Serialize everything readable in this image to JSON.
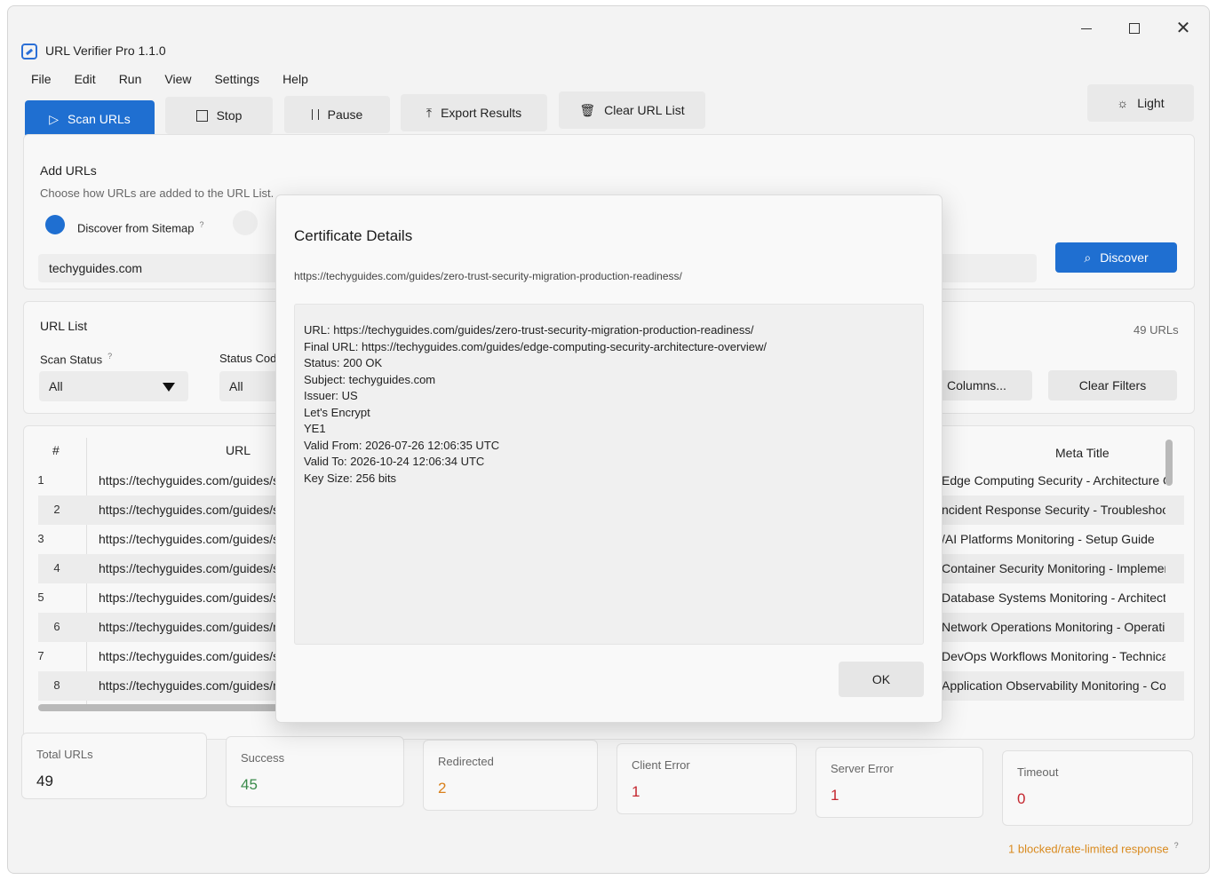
{
  "app": {
    "title": "URL Verifier Pro 1.1.0"
  },
  "menu": [
    "File",
    "Edit",
    "Run",
    "View",
    "Settings",
    "Help"
  ],
  "toolbar": {
    "scan": "Scan URLs",
    "stop": "Stop",
    "pause": "Pause",
    "export": "Export Results",
    "clear": "Clear URL List",
    "theme": "Light"
  },
  "add_urls": {
    "title": "Add URLs",
    "subtitle": "Choose how URLs are added to the URL List.",
    "option_sitemap": "Discover from Sitemap",
    "help": "?",
    "domain_value": "techyguides.com",
    "discover_button": "Discover"
  },
  "url_list": {
    "title": "URL List",
    "count": "49 URLs",
    "scan_status_label": "Scan Status",
    "scan_status_value": "All",
    "status_code_label": "Status Cod",
    "status_code_value": "All",
    "columns_button": "Columns...",
    "clear_filters_button": "Clear Filters",
    "help": "?"
  },
  "table": {
    "col_num": "#",
    "col_url": "URL",
    "col_meta": "Meta Title",
    "rows": [
      {
        "num": "1",
        "url": "https://techyguides.com/guides/s",
        "meta": "Edge Computing Security - Architecture Ove"
      },
      {
        "num": "2",
        "url": "https://techyguides.com/guides/s",
        "meta": "ncident Response Security - Troubleshootin"
      },
      {
        "num": "3",
        "url": "https://techyguides.com/guides/s",
        "meta": "/AI Platforms Monitoring - Setup Guide"
      },
      {
        "num": "4",
        "url": "https://techyguides.com/guides/s",
        "meta": "Container Security Monitoring - Implementa"
      },
      {
        "num": "5",
        "url": "https://techyguides.com/guides/s",
        "meta": "Database Systems Monitoring - Architecture"
      },
      {
        "num": "6",
        "url": "https://techyguides.com/guides/n",
        "meta": "Network Operations Monitoring - Operation"
      },
      {
        "num": "7",
        "url": "https://techyguides.com/guides/s",
        "meta": "DevOps Workflows Monitoring - Technical T"
      },
      {
        "num": "8",
        "url": "https://techyguides.com/guides/n",
        "meta": "Application Observability Monitoring - Com"
      }
    ]
  },
  "stats": [
    {
      "label": "Total URLs",
      "value": "49",
      "color": "#1f1f1f"
    },
    {
      "label": "Success",
      "value": "45",
      "color": "#3a8a4a"
    },
    {
      "label": "Redirected",
      "value": "2",
      "color": "#d9801c"
    },
    {
      "label": "Client Error",
      "value": "1",
      "color": "#c4262e"
    },
    {
      "label": "Server Error",
      "value": "1",
      "color": "#c4262e"
    },
    {
      "label": "Timeout",
      "value": "0",
      "color": "#c4262e"
    }
  ],
  "footnote": "1 blocked/rate-limited response",
  "footnote_help": "?",
  "dialog": {
    "title": "Certificate Details",
    "url": "https://techyguides.com/guides/zero-trust-security-migration-production-readiness/",
    "lines": [
      "URL: https://techyguides.com/guides/zero-trust-security-migration-production-readiness/",
      "Final URL: https://techyguides.com/guides/edge-computing-security-architecture-overview/",
      "Status: 200 OK",
      "Subject: techyguides.com",
      "Issuer: US",
      "Let's Encrypt",
      "YE1",
      "Valid From: 2026-07-26 12:06:35 UTC",
      "Valid To: 2026-10-24 12:06:34 UTC",
      "Key Size: 256 bits"
    ],
    "ok": "OK"
  },
  "colors": {
    "accent": "#1f6fd1",
    "success": "#3a8a4a",
    "warning": "#d9801c",
    "error": "#c4262e"
  }
}
